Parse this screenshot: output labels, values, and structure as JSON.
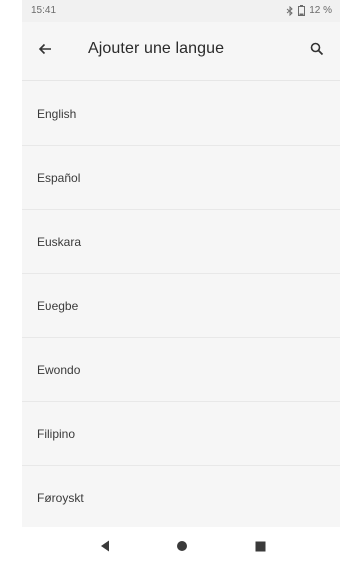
{
  "status_bar": {
    "time": "15:41",
    "battery": "12 %",
    "icons": [
      "bluetooth-icon",
      "battery-icon"
    ]
  },
  "app_bar": {
    "title": "Ajouter une langue",
    "back_icon": "arrow-back-icon",
    "search_icon": "search-icon"
  },
  "languages": [
    "English",
    "Español",
    "Euskara",
    "Eʋegbe",
    "Ewondo",
    "Filipino",
    "Føroyskt"
  ],
  "nav_bar": {
    "icons": [
      "nav-back-icon",
      "nav-home-icon",
      "nav-recents-icon"
    ]
  },
  "colors": {
    "background": "#f6f6f6",
    "text": "#2a2a2a",
    "divider": "#e8e8e8"
  }
}
